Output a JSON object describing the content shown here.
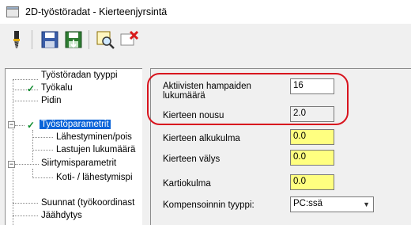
{
  "window": {
    "title": "2D-työstöradat - Kierteenjyrsintä"
  },
  "toolbar": {
    "buttons": [
      "tool-icon",
      "save-icon",
      "save-as-icon",
      "preview-icon",
      "delete-icon"
    ]
  },
  "tree": {
    "items": [
      {
        "label": "Työstöradan tyyppi",
        "checked": false
      },
      {
        "label": "Työkalu",
        "checked": true
      },
      {
        "label": "Pidin",
        "checked": false
      },
      {
        "label": "Työstöparametrit",
        "checked": true,
        "selected": true
      },
      {
        "label": "Lähestyminen/pois",
        "checked": false
      },
      {
        "label": "Lastujen lukumäärä",
        "checked": false
      },
      {
        "label": "Siirtymisparametrit",
        "checked": false
      },
      {
        "label": "Koti- / lähestymispi",
        "checked": false
      },
      {
        "label": "Suunnat (työkoordinast",
        "checked": false
      },
      {
        "label": "Jäähdytys",
        "checked": false
      }
    ]
  },
  "params": {
    "active_teeth_label_1": "Aktiivisten hampaiden",
    "active_teeth_label_2": "lukumäärä",
    "active_teeth_value": "16",
    "thread_lead_label": "Kierteen nousu",
    "thread_lead_value": "2.0",
    "start_angle_label": "Kierteen alkukulma",
    "start_angle_value": "0.0",
    "clearance_label": "Kierteen välys",
    "clearance_value": "0.0",
    "cone_angle_label": "Kartiokulma",
    "cone_angle_value": "0.0",
    "comp_type_label": "Kompensoinnin tyyppi:",
    "comp_type_value": "PC:ssä"
  },
  "colors": {
    "highlight": "#d8141e",
    "input_yellow": "#ffff80",
    "selected": "#0a64d8"
  }
}
